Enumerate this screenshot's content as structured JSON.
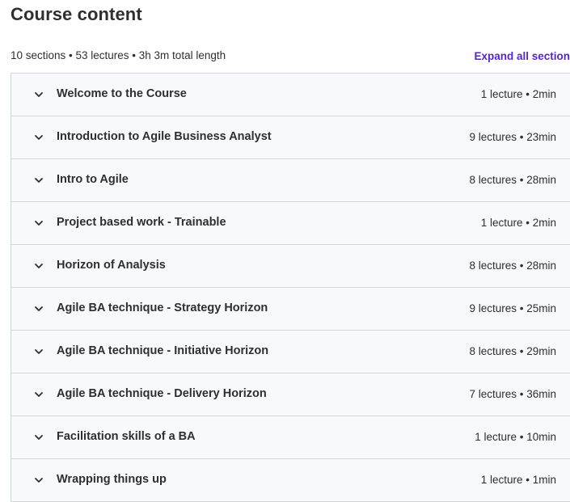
{
  "header": {
    "title": "Course content"
  },
  "summary": {
    "text": "10 sections • 53 lectures • 3h 3m total length",
    "expand_label": "Expand all section"
  },
  "colors": {
    "accent": "#5624d0",
    "row_background": "#f7f9fa",
    "border": "#d1d7dc",
    "text": "#2d2f31"
  },
  "sections": [
    {
      "title": "Welcome to the Course",
      "meta": "1 lecture • 2min",
      "icon": "chevron-down-icon"
    },
    {
      "title": "Introduction to Agile Business Analyst",
      "meta": "9 lectures • 23min",
      "icon": "chevron-down-icon"
    },
    {
      "title": "Intro to Agile",
      "meta": "8 lectures • 28min",
      "icon": "chevron-down-icon"
    },
    {
      "title": "Project based work - Trainable",
      "meta": "1 lecture • 2min",
      "icon": "chevron-down-icon"
    },
    {
      "title": "Horizon of Analysis",
      "meta": "8 lectures • 28min",
      "icon": "chevron-down-icon"
    },
    {
      "title": "Agile BA technique - Strategy Horizon",
      "meta": "9 lectures • 25min",
      "icon": "chevron-down-icon"
    },
    {
      "title": "Agile BA technique - Initiative Horizon",
      "meta": "8 lectures • 29min",
      "icon": "chevron-down-icon"
    },
    {
      "title": "Agile BA technique - Delivery Horizon",
      "meta": "7 lectures • 36min",
      "icon": "chevron-down-icon"
    },
    {
      "title": "Facilitation skills of a BA",
      "meta": "1 lecture • 10min",
      "icon": "chevron-down-icon"
    },
    {
      "title": "Wrapping things up",
      "meta": "1 lecture • 1min",
      "icon": "chevron-down-icon"
    }
  ]
}
